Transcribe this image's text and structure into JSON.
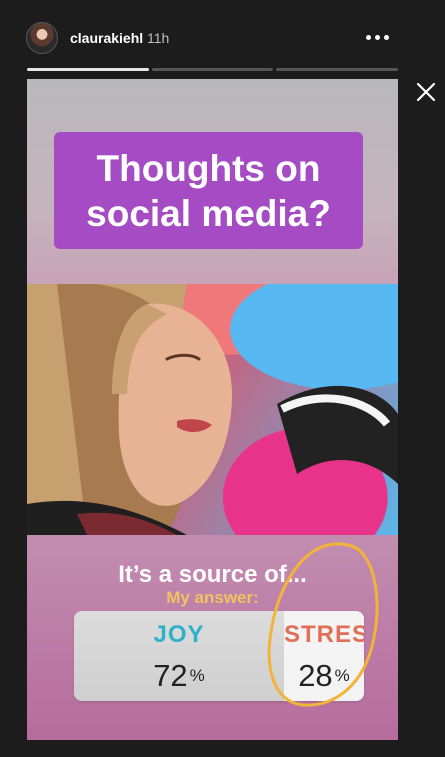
{
  "header": {
    "username": "claurakiehl",
    "time": "11h",
    "more_icon": "more-horizontal-icon",
    "close_icon": "close-icon",
    "progress": [
      {
        "state": "active"
      },
      {
        "state": "inactive"
      },
      {
        "state": "inactive"
      }
    ]
  },
  "story": {
    "question_line1": "Thoughts on",
    "question_line2": "social media?",
    "poll_title": "It’s a source of...",
    "my_answer": "My answer:",
    "options": [
      {
        "label": "JOY",
        "percent": "72",
        "percent_sign": "%",
        "color": "#2cb2c8"
      },
      {
        "label": "STRESS",
        "percent": "28",
        "percent_sign": "%",
        "color": "#e06e58"
      }
    ],
    "colors": {
      "question_background": "#a54cc4",
      "my_answer_color": "#f3c15f",
      "highlight_circle": "#f2b339"
    }
  }
}
